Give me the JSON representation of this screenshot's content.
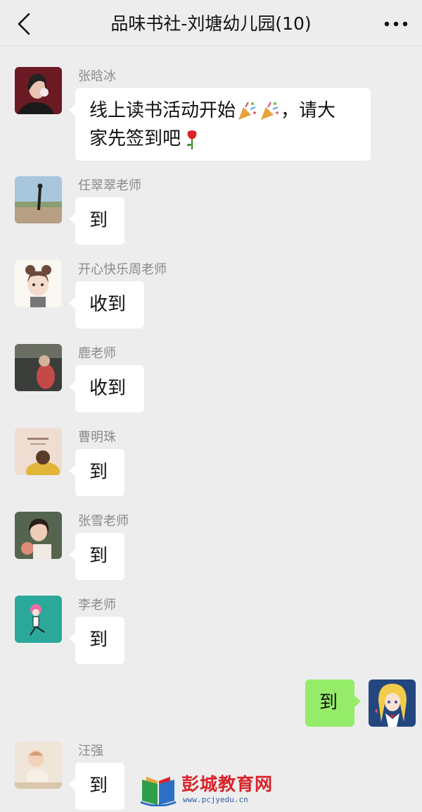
{
  "header": {
    "title": "品味书社-刘塘幼儿园(10)",
    "back_icon": "chevron-left-icon",
    "more_icon": "more-dots-icon"
  },
  "messages": [
    {
      "sender": "张晗冰",
      "text_a": "线上读书活动开始",
      "text_b": "，请大",
      "text_c": "家先签到吧",
      "avatar_color": "#6b1a24"
    },
    {
      "sender": "任翠翠老师",
      "text": "到",
      "avatar_color": "#7ea7c4"
    },
    {
      "sender": "开心快乐周老师",
      "text": "收到",
      "avatar_color": "#f3ece6"
    },
    {
      "sender": "鹿老师",
      "text": "收到",
      "avatar_color": "#3c3c3c"
    },
    {
      "sender": "曹明珠",
      "text": "到",
      "avatar_color": "#efd6c8"
    },
    {
      "sender": "张雪老师",
      "text": "到",
      "avatar_color": "#6b7a65"
    },
    {
      "sender": "李老师",
      "text": "到",
      "avatar_color": "#2aa89a"
    },
    {
      "sender": "",
      "text": "到",
      "avatar_color": "#2a4f8f",
      "self": true
    },
    {
      "sender": "汪强",
      "text": "到",
      "avatar_color": "#e9dccd"
    }
  ],
  "watermark": {
    "name": "彭城教育网",
    "url": "www.pcjyedu.cn"
  }
}
